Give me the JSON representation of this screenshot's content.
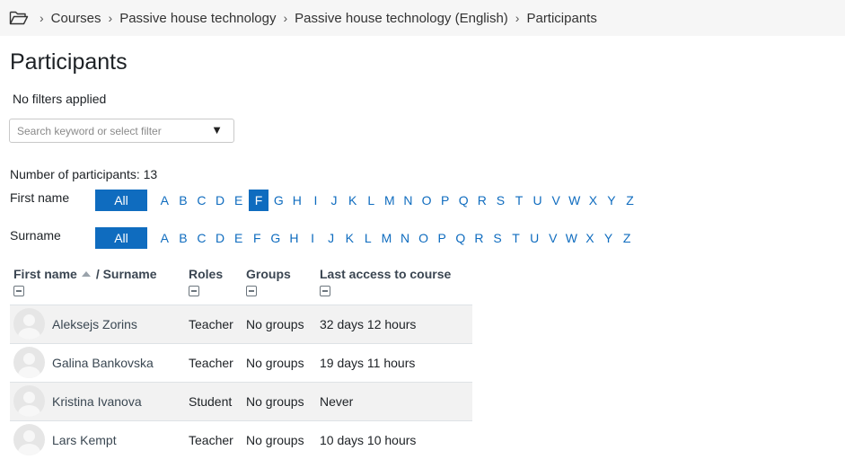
{
  "breadcrumb": {
    "items": [
      "Courses",
      "Passive house technology",
      "Passive house technology (English)",
      "Participants"
    ],
    "separator": "›"
  },
  "page": {
    "title": "Participants",
    "filters_label": "No filters applied",
    "search_placeholder": "Search keyword or select filter",
    "count_label": "Number of participants: 13"
  },
  "initials": {
    "first_name_label": "First name",
    "surname_label": "Surname",
    "all_label": "All",
    "letters": [
      "A",
      "B",
      "C",
      "D",
      "E",
      "F",
      "G",
      "H",
      "I",
      "J",
      "K",
      "L",
      "M",
      "N",
      "O",
      "P",
      "Q",
      "R",
      "S",
      "T",
      "U",
      "V",
      "W",
      "X",
      "Y",
      "Z"
    ],
    "first_active": "F",
    "surname_active": "All"
  },
  "table": {
    "headers": {
      "first_name": "First name",
      "surname": "/ Surname",
      "roles": "Roles",
      "groups": "Groups",
      "last_access": "Last access to course"
    },
    "rows": [
      {
        "name": "Aleksejs Zorins",
        "role": "Teacher",
        "groups": "No groups",
        "last_access": "32 days 12 hours"
      },
      {
        "name": "Galina Bankovska",
        "role": "Teacher",
        "groups": "No groups",
        "last_access": "19 days 11 hours"
      },
      {
        "name": "Kristina Ivanova",
        "role": "Student",
        "groups": "No groups",
        "last_access": "Never"
      },
      {
        "name": "Lars Kempt",
        "role": "Teacher",
        "groups": "No groups",
        "last_access": "10 days 10 hours"
      }
    ]
  },
  "colors": {
    "accent": "#0f6cbf",
    "breadcrumb_bg": "#f6f6f6",
    "row_stripe": "#f2f2f2"
  },
  "icons": {
    "breadcrumb_home": "folder-open-icon",
    "sort": "sort-ascending-icon",
    "collapse": "collapse-column-icon",
    "dropdown": "caret-down-icon",
    "avatar": "default-user-avatar"
  }
}
